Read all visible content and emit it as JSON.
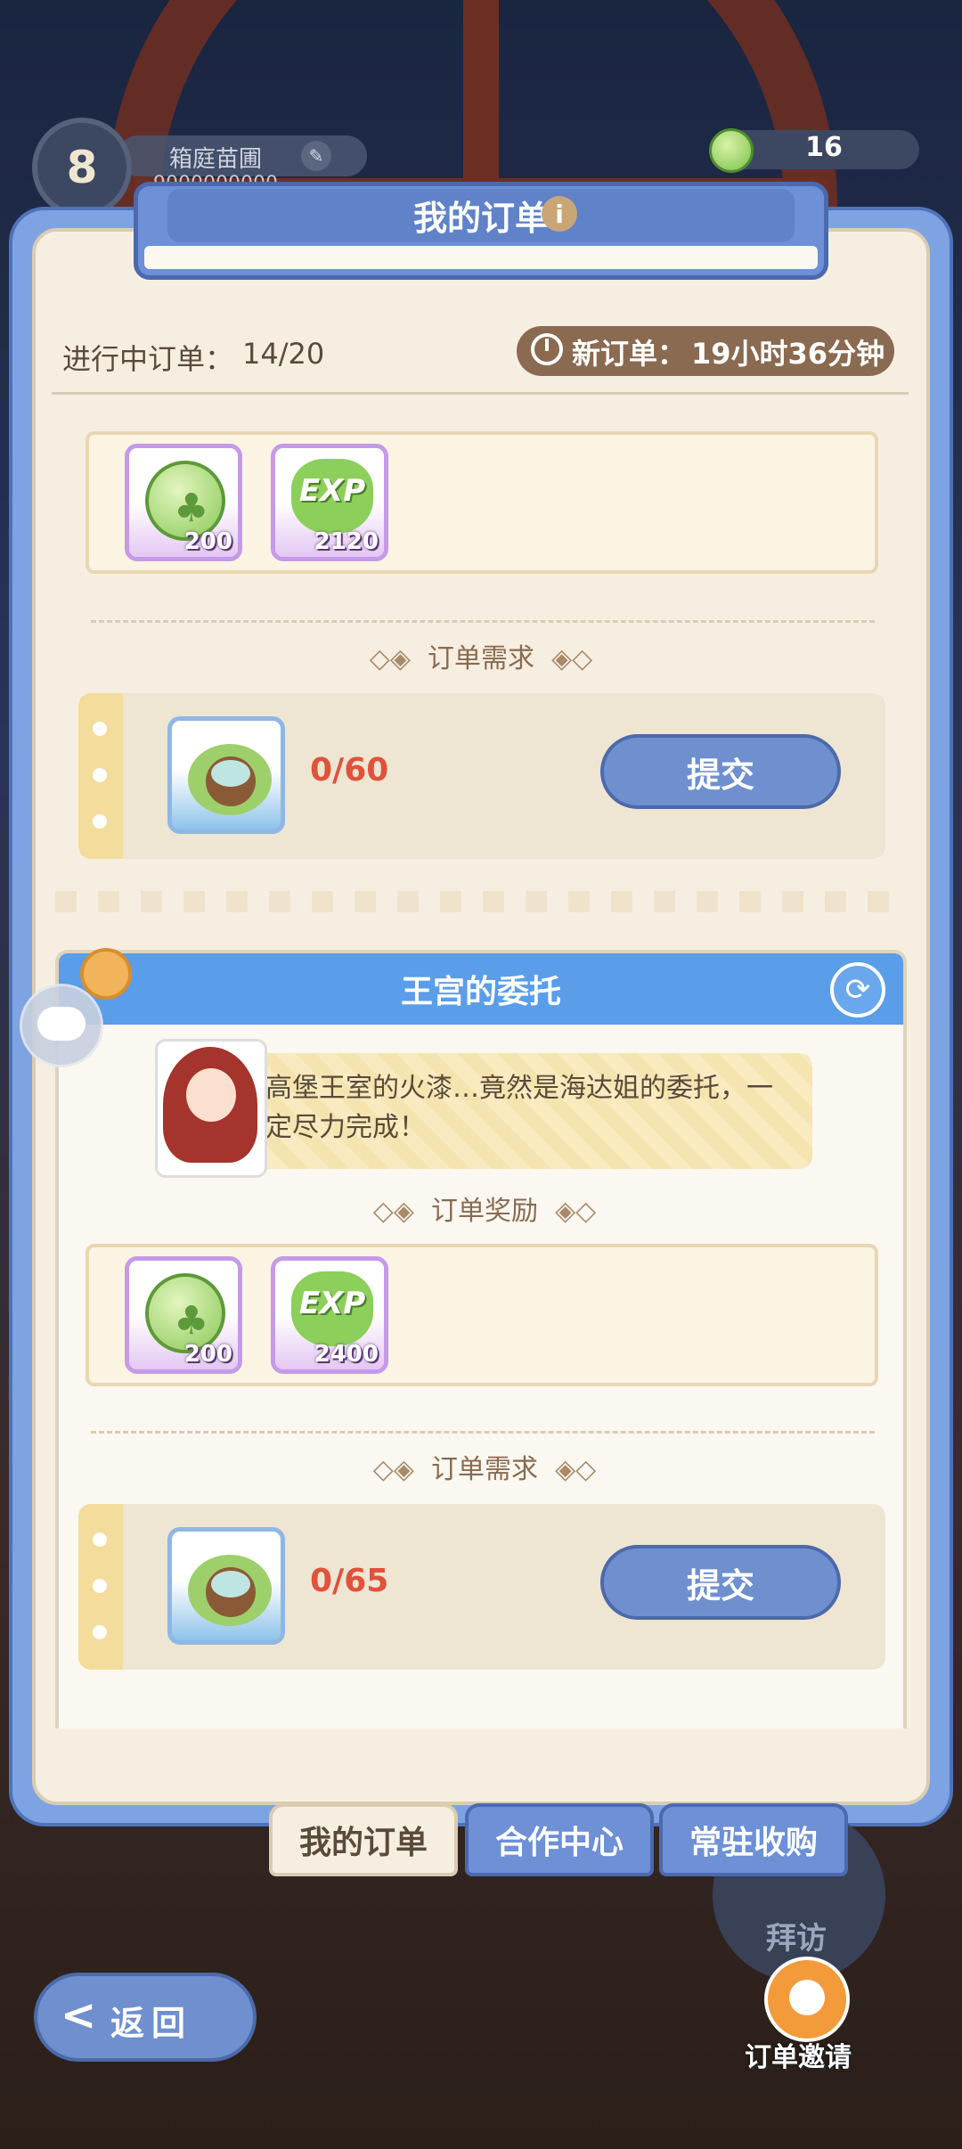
{
  "player": {
    "level": "8",
    "name": "箱庭苗圃",
    "id": "9000000000"
  },
  "currency": {
    "value": "16"
  },
  "panel": {
    "title": "我的订单",
    "info_icon": "i"
  },
  "status": {
    "ongoing_label": "进行中订单：",
    "ongoing_value": "14/20",
    "new_order_label": "新订单：",
    "new_order_time": "19小时36分钟"
  },
  "orders": [
    {
      "rewards": [
        {
          "icon": "clover-coin-icon",
          "amount": "200"
        },
        {
          "icon": "exp-clover-icon",
          "label": "EXP",
          "amount": "2120"
        }
      ],
      "requirement_title": "订单需求",
      "requirement": {
        "icon": "coconut-drink-icon",
        "progress": "0/60"
      },
      "submit_label": "提交"
    },
    {
      "title": "王宫的委托",
      "dialogue": "高堡王室的火漆…竟然是海达姐的委托，一定尽力完成！",
      "reward_title": "订单奖励",
      "rewards": [
        {
          "icon": "clover-coin-icon",
          "amount": "200"
        },
        {
          "icon": "exp-clover-icon",
          "label": "EXP",
          "amount": "2400"
        }
      ],
      "requirement_title": "订单需求",
      "requirement": {
        "icon": "coconut-drink-icon",
        "progress": "0/65"
      },
      "submit_label": "提交"
    }
  ],
  "tabs": [
    {
      "label": "我的订单"
    },
    {
      "label": "合作中心"
    },
    {
      "label": "常驻收购"
    }
  ],
  "visit": {
    "label": "拜访"
  },
  "back": {
    "arrow": "<",
    "label": "返回"
  },
  "invite": {
    "label": "订单邀请"
  },
  "colors": {
    "panel_blue": "#7ea3e3",
    "header_blue": "#5a9de8",
    "accent_red": "#e0523a",
    "paper": "#f6efe1"
  }
}
